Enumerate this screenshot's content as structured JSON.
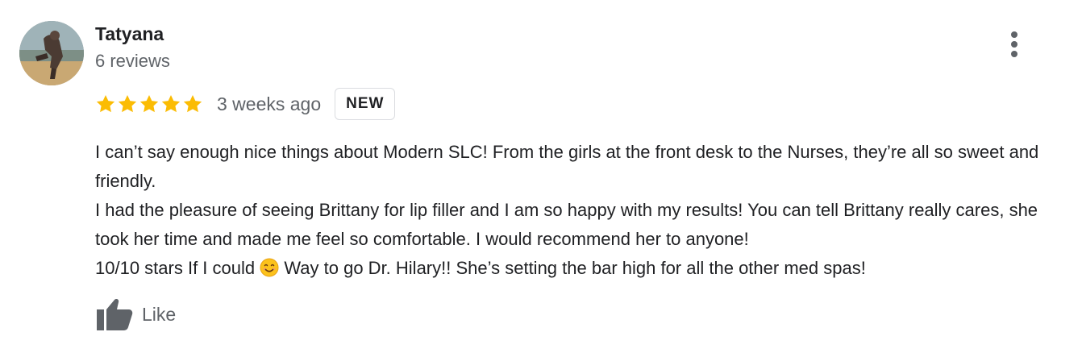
{
  "review": {
    "author_name": "Tatyana",
    "review_count": "6 reviews",
    "rating": 5,
    "rating_max": 5,
    "time_ago": "3 weeks ago",
    "badge": "NEW",
    "text_lines": [
      "I can’t say enough nice things about Modern SLC! From the girls at the front desk to the Nurses, they’re all so sweet and friendly.",
      "I had the pleasure of seeing Brittany for lip filler and I am so happy with my results! You can tell Brittany really cares, she took her time and made me feel so comfortable. I would recommend her to anyone!"
    ],
    "text_last_before_emoji": "10/10 stars If I could ",
    "text_last_after_emoji": " Way to go Dr. Hilary!! She’s setting the bar high for all the other med spas!",
    "like_label": "Like"
  },
  "colors": {
    "star": "#fbbc04",
    "secondary_text": "#5f6368",
    "primary_text": "#202124",
    "badge_border": "#dadce0"
  },
  "icons": {
    "more": "more-vert-icon",
    "like": "thumb-up-icon",
    "emoji": "smiling-face-emoji",
    "star": "star-icon"
  }
}
